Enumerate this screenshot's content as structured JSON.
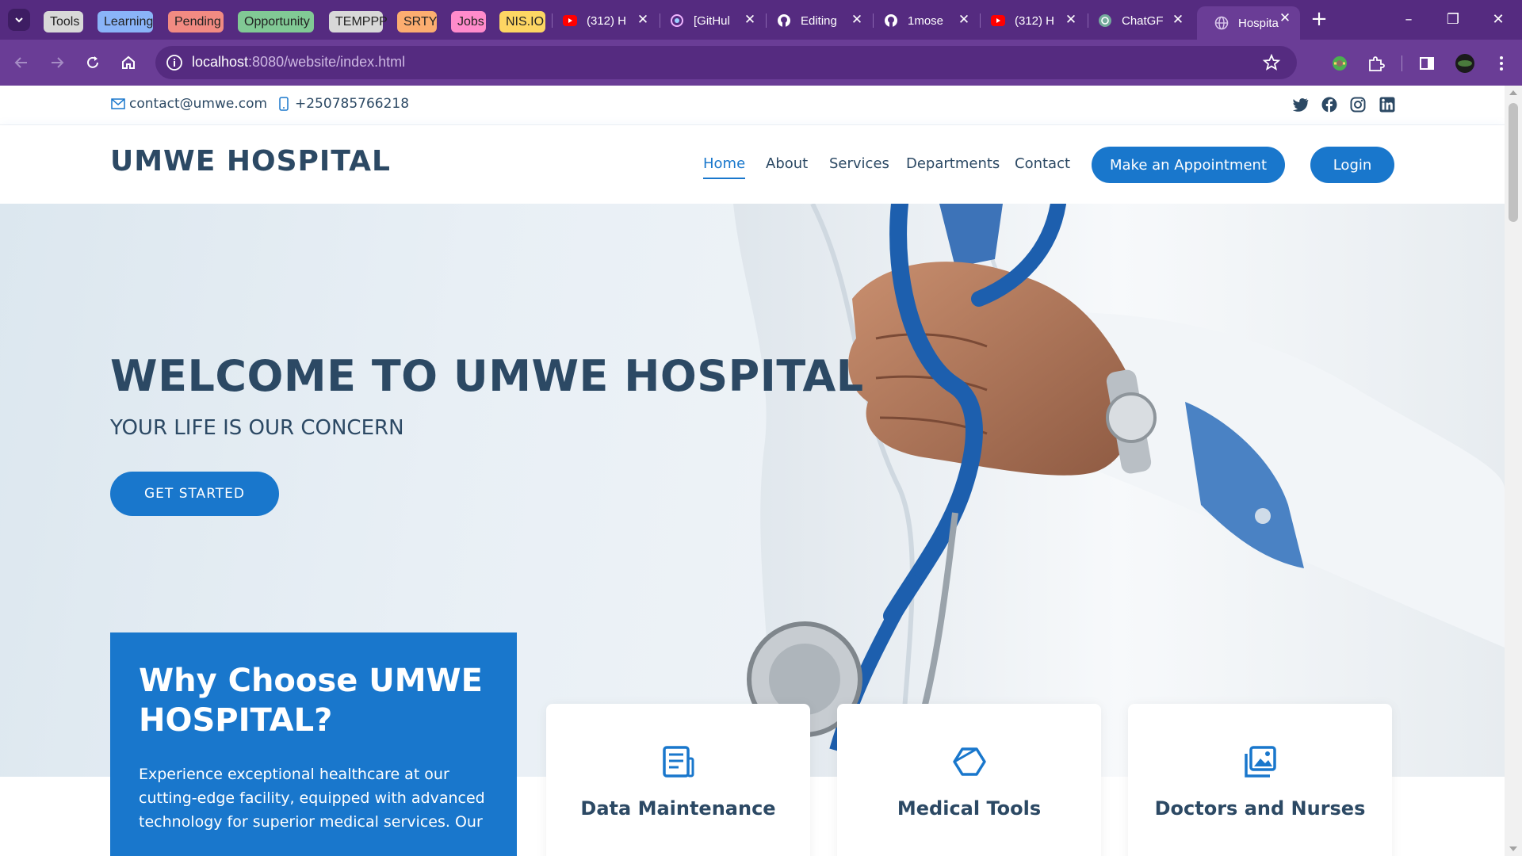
{
  "browser": {
    "bookmark_chips": [
      {
        "label": "Tools",
        "color": "#d8d8d8"
      },
      {
        "label": "Learning",
        "color": "#8ab4f8"
      },
      {
        "label": "Pending",
        "color": "#f28b82"
      },
      {
        "label": "Opportunity",
        "color": "#81c995"
      },
      {
        "label": "TEMPPP",
        "color": "#d8d8d8"
      },
      {
        "label": "SRTY",
        "color": "#fcad70"
      },
      {
        "label": "Jobs",
        "color": "#ff8bcb"
      },
      {
        "label": "NIS.IO",
        "color": "#fdd663"
      }
    ],
    "tabs": [
      {
        "title": "(312) H",
        "icon": "youtube-icon"
      },
      {
        "title": "[GitHul",
        "icon": "github-copilot-icon"
      },
      {
        "title": "Editing",
        "icon": "github-icon"
      },
      {
        "title": "1mose",
        "icon": "github-icon"
      },
      {
        "title": "(312) H",
        "icon": "youtube-icon"
      },
      {
        "title": "ChatGF",
        "icon": "chatgpt-icon"
      },
      {
        "title": "Hospita",
        "icon": "globe-icon",
        "active": true
      }
    ],
    "url_host": "localhost",
    "url_rest": ":8080/website/index.html"
  },
  "topbar": {
    "email": "contact@umwe.com",
    "phone": "+250785766218",
    "socials": [
      "twitter-icon",
      "facebook-icon",
      "instagram-icon",
      "linkedin-icon"
    ]
  },
  "header": {
    "logo": "UMWE HOSPITAL",
    "nav": [
      "Home",
      "About",
      "Services",
      "Departments",
      "Contact"
    ],
    "appointment_button": "Make an Appointment",
    "login_button": "Login"
  },
  "hero": {
    "title": "WELCOME TO UMWE HOSPITAL",
    "subtitle": "YOUR LIFE IS OUR CONCERN",
    "cta": "GET STARTED"
  },
  "why": {
    "title": "Why Choose UMWE HOSPITAL?",
    "text": "Experience exceptional healthcare at our cutting-edge facility, equipped with advanced technology for superior medical services. Our"
  },
  "features": [
    {
      "title": "Data Maintenance",
      "icon": "document-icon"
    },
    {
      "title": "Medical Tools",
      "icon": "hexagon-icon"
    },
    {
      "title": "Doctors and Nurses",
      "icon": "images-icon"
    }
  ],
  "colors": {
    "accent": "#1977cc",
    "heading": "#2c4964",
    "browser_frame": "#552b80",
    "browser_toolbar": "#6a3d96"
  }
}
